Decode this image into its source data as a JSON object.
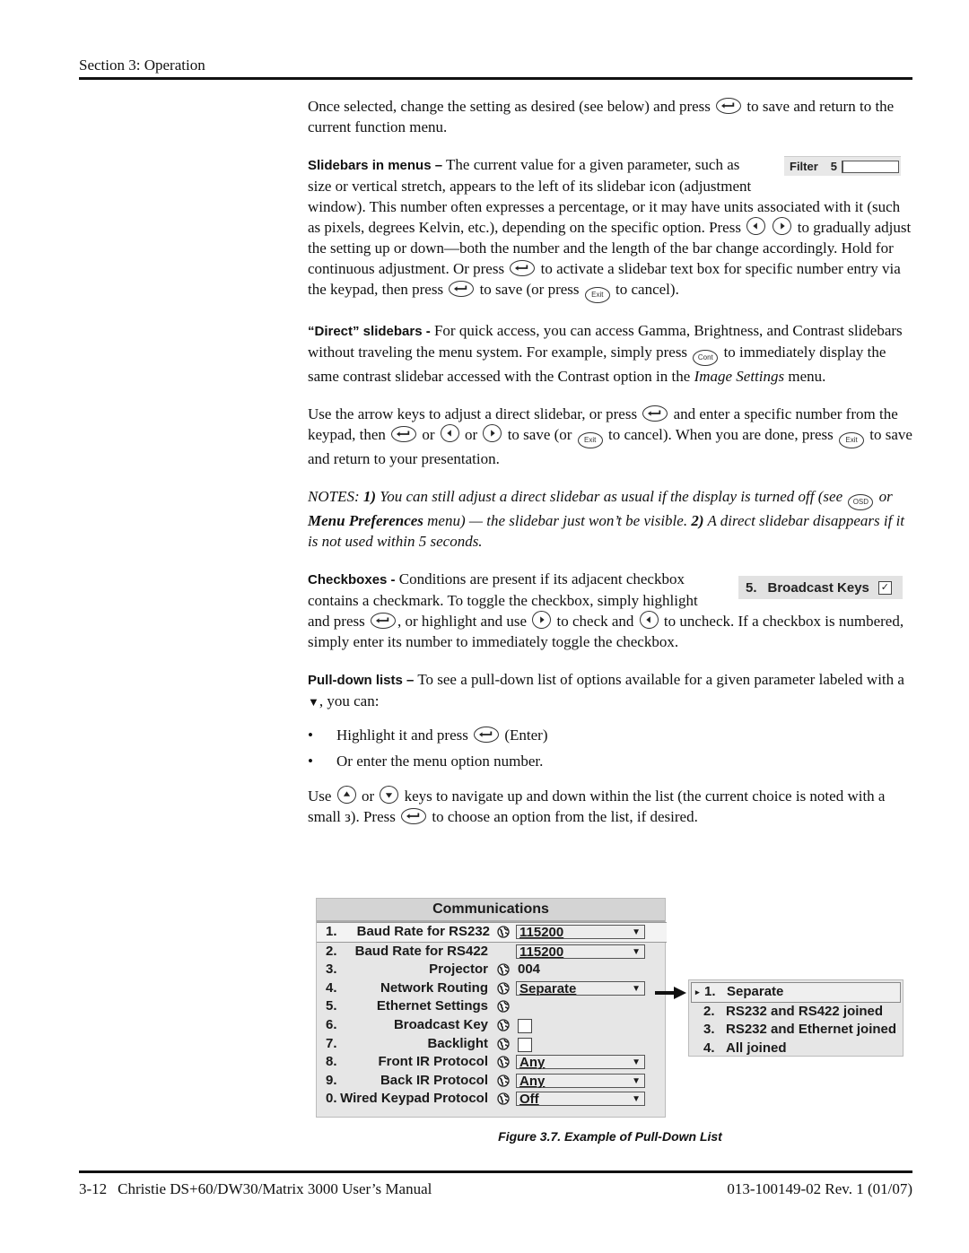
{
  "header": {
    "section": "Section 3: Operation"
  },
  "intro": {
    "before": "Once selected, change the setting as desired (see below) and press",
    "after": "to save and return to the current function menu."
  },
  "slidebars": {
    "heading": "Slidebars in menus –",
    "t1": "The current value for a given parameter, such as size or vertical stretch, appears to the left of its slidebar icon (adjustment window). This number often expresses a percentage, or it may have units associated with it (such as pixels, degrees Kelvin, etc.), depending on the specific option. Press",
    "t2": "to gradually adjust the setting up or down—both the number and the length of the bar change accordingly. Hold for continuous adjustment. Or press",
    "t3": "to activate a slidebar text box for specific number entry via the keypad, then press",
    "t4": "to save (or press",
    "t5": "to cancel).",
    "widget": {
      "label": "Filter",
      "value": "5",
      "fill_fraction": 0.02
    }
  },
  "direct": {
    "heading": "“Direct” slidebars -",
    "t1": "For quick access, you can access Gamma, Brightness, and Contrast slidebars without traveling the menu system. For example, simply press",
    "t2": "to immediately display the same contrast slidebar accessed with the Contrast option in the",
    "t2_italic": "Image Settings",
    "t3": "menu."
  },
  "arrow_para": {
    "t1": "Use the arrow keys to adjust a direct slidebar, or press",
    "t2": "and enter a specific number from the keypad, then",
    "or1": "or",
    "or2": "or",
    "t3": "to save (or",
    "t4": "to cancel). When you are done, press",
    "t5": "to save and return to your presentation."
  },
  "notes": {
    "p1": "NOTES: ",
    "n1": "1)",
    "t1": " You can still adjust a direct slidebar as usual if the display is turned off (see ",
    "t2": " or ",
    "menu_pref": "Menu Preferences",
    "t3": " menu) — the slidebar just won’t be visible. ",
    "n2": "2)",
    "t4": " A direct slidebar disappears if it is not used within 5 seconds."
  },
  "checkboxes": {
    "heading": "Checkboxes -",
    "t1": "Conditions are present if its adjacent checkbox contains a checkmark. To toggle the checkbox, simply highlight and press",
    "t2": ", or highlight and use",
    "t3": "to check and",
    "t4": "to uncheck. If a checkbox is numbered, simply enter its number to immediately toggle the checkbox.",
    "widget": {
      "num": "5.",
      "label": "Broadcast Keys",
      "checked": true,
      "check_glyph": "✓"
    }
  },
  "pulldown": {
    "heading": "Pull-down lists –",
    "t1": "To see a pull-down list of options available for a given parameter labeled with a",
    "tri": "▼",
    "t2": ", you can:",
    "bullet": "•",
    "b1_before": "Highlight it and press",
    "b1_after": "(Enter)",
    "b2": "Or enter the menu option number.",
    "u1": "Use",
    "u_or": "or",
    "u2": "keys to navigate up and down within the list (the current choice is noted with a small з). Press",
    "u3": "to choose an option from the list, if desired."
  },
  "keys": {
    "exit": "Exit",
    "cont": "Cont",
    "osd": "OSD"
  },
  "figure": {
    "menu_title": "Communications",
    "rows": [
      {
        "num": "1.",
        "label": "Baud Rate for RS232",
        "globe": true,
        "type": "dropdown",
        "value": "115200",
        "selected": true
      },
      {
        "num": "2.",
        "label": "Baud Rate for RS422",
        "globe": false,
        "type": "dropdown",
        "value": "115200"
      },
      {
        "num": "3.",
        "label": "Projector",
        "globe": true,
        "type": "text",
        "value": "004"
      },
      {
        "num": "4.",
        "label": "Network Routing",
        "globe": true,
        "type": "dropdown",
        "value": "Separate"
      },
      {
        "num": "5.",
        "label": "Ethernet Settings",
        "globe": true,
        "type": "none",
        "value": ""
      },
      {
        "num": "6.",
        "label": "Broadcast Key",
        "globe": true,
        "type": "checkbox",
        "checked": false
      },
      {
        "num": "7.",
        "label": "Backlight",
        "globe": true,
        "type": "checkbox",
        "checked": false
      },
      {
        "num": "8.",
        "label": "Front IR Protocol",
        "globe": true,
        "type": "dropdown",
        "value": "Any"
      },
      {
        "num": "9.",
        "label": "Back IR Protocol",
        "globe": true,
        "type": "dropdown",
        "value": "Any"
      },
      {
        "num": "0.",
        "label": "Wired Keypad Protocol",
        "globe": true,
        "type": "dropdown",
        "value": "Off"
      }
    ],
    "dropdown_arrow": "▼",
    "popup_options": [
      {
        "num": "1.",
        "label": "Separate",
        "current": true
      },
      {
        "num": "2.",
        "label": "RS232 and RS422 joined"
      },
      {
        "num": "3.",
        "label": "RS232 and Ethernet joined"
      },
      {
        "num": "4.",
        "label": "All joined"
      }
    ],
    "current_marker": "▸",
    "caption": "Figure 3.7. Example of Pull-Down List"
  },
  "footer": {
    "page": "3-12",
    "title": "Christie DS+60/DW30/Matrix 3000 User’s Manual",
    "doc_number": "013-100149-02 Rev. 1 (01/07)"
  }
}
